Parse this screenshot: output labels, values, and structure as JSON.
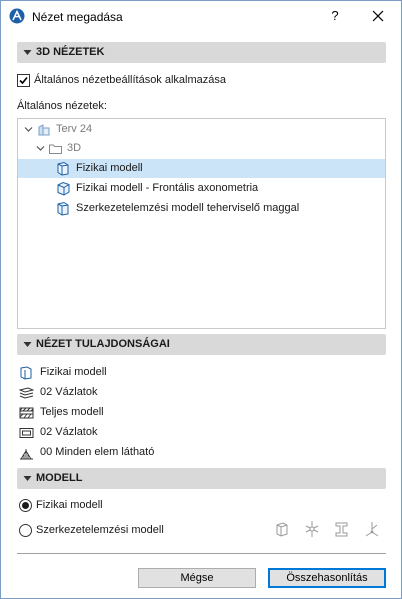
{
  "window": {
    "title": "Nézet megadása",
    "help_label": "?"
  },
  "sections": {
    "views_3d": "3D NÉZETEK",
    "view_properties": "NÉZET TULAJDONSÁGAI",
    "model": "MODELL"
  },
  "general_settings": {
    "checkbox_label": "Általános nézetbeállítások alkalmazása",
    "checked": true
  },
  "tree": {
    "label": "Általános nézetek:",
    "items": [
      {
        "label": "Terv 24",
        "icon": "project-icon",
        "muted": true
      },
      {
        "label": "3D",
        "icon": "folder-icon",
        "muted": true
      },
      {
        "label": "Fizikai modell",
        "icon": "3d-view-icon",
        "selected": true
      },
      {
        "label": "Fizikai modell - Frontális axonometria",
        "icon": "axonometric-view-icon"
      },
      {
        "label": "Szerkezetelemzési modell teherviselő maggal",
        "icon": "3d-view-icon"
      }
    ]
  },
  "properties": [
    {
      "label": "Fizikai modell",
      "icon": "model-view-icon"
    },
    {
      "label": "02 Vázlatok",
      "icon": "layer-combination-icon"
    },
    {
      "label": "Teljes modell",
      "icon": "partial-structure-icon"
    },
    {
      "label": "02 Vázlatok",
      "icon": "graphic-override-icon"
    },
    {
      "label": "00 Minden elem látható",
      "icon": "renovation-filter-icon"
    }
  ],
  "model_options": {
    "options": [
      {
        "label": "Fizikai modell",
        "selected": true
      },
      {
        "label": "Szerkezetelemzési modell",
        "selected": false
      }
    ],
    "tool_icons": [
      "analytical-column-icon",
      "analytical-node-icon",
      "analytical-beam-icon",
      "analytical-axes-icon"
    ]
  },
  "buttons": {
    "cancel": "Mégse",
    "compare": "Összehasonlítás"
  }
}
